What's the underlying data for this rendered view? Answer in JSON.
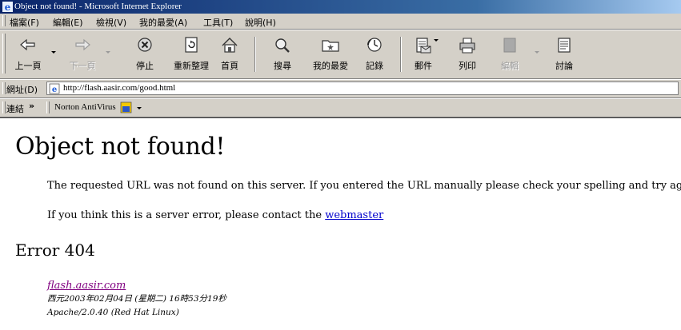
{
  "window": {
    "title": "Object not found! - Microsoft Internet Explorer"
  },
  "menu": {
    "items": [
      "檔案(F)",
      "編輯(E)",
      "檢視(V)",
      "我的最愛(A)",
      "工具(T)",
      "說明(H)"
    ]
  },
  "toolbar": {
    "back": "上一頁",
    "forward": "下一頁",
    "stop": "停止",
    "refresh": "重新整理",
    "home": "首頁",
    "search": "搜尋",
    "favorites": "我的最愛",
    "history": "記錄",
    "mail": "郵件",
    "print": "列印",
    "edit": "編輯",
    "discuss": "討論"
  },
  "address": {
    "label": "網址(D)",
    "url": "http://flash.aasir.com/good.html"
  },
  "links": {
    "label": "連結",
    "chevron": "»",
    "norton": "Norton AntiVirus"
  },
  "page": {
    "heading": "Object not found!",
    "message": "The requested URL was not found on this server. If you entered the URL manually please check your spelling and try again.",
    "contact_prefix": "If you think this is a server error, please contact the ",
    "contact_link": "webmaster",
    "error_heading": "Error 404",
    "host_link": "flash.aasir.com",
    "timestamp": "西元2003年02月04日 (星期二) 16時53分19秒",
    "server": "Apache/2.0.40 (Red Hat Linux)"
  },
  "colors": {
    "titlebar_start": "#0a246a",
    "titlebar_end": "#a6caf0",
    "chrome": "#d4d0c8",
    "link": "#0000cc",
    "visited_link": "#800080"
  }
}
